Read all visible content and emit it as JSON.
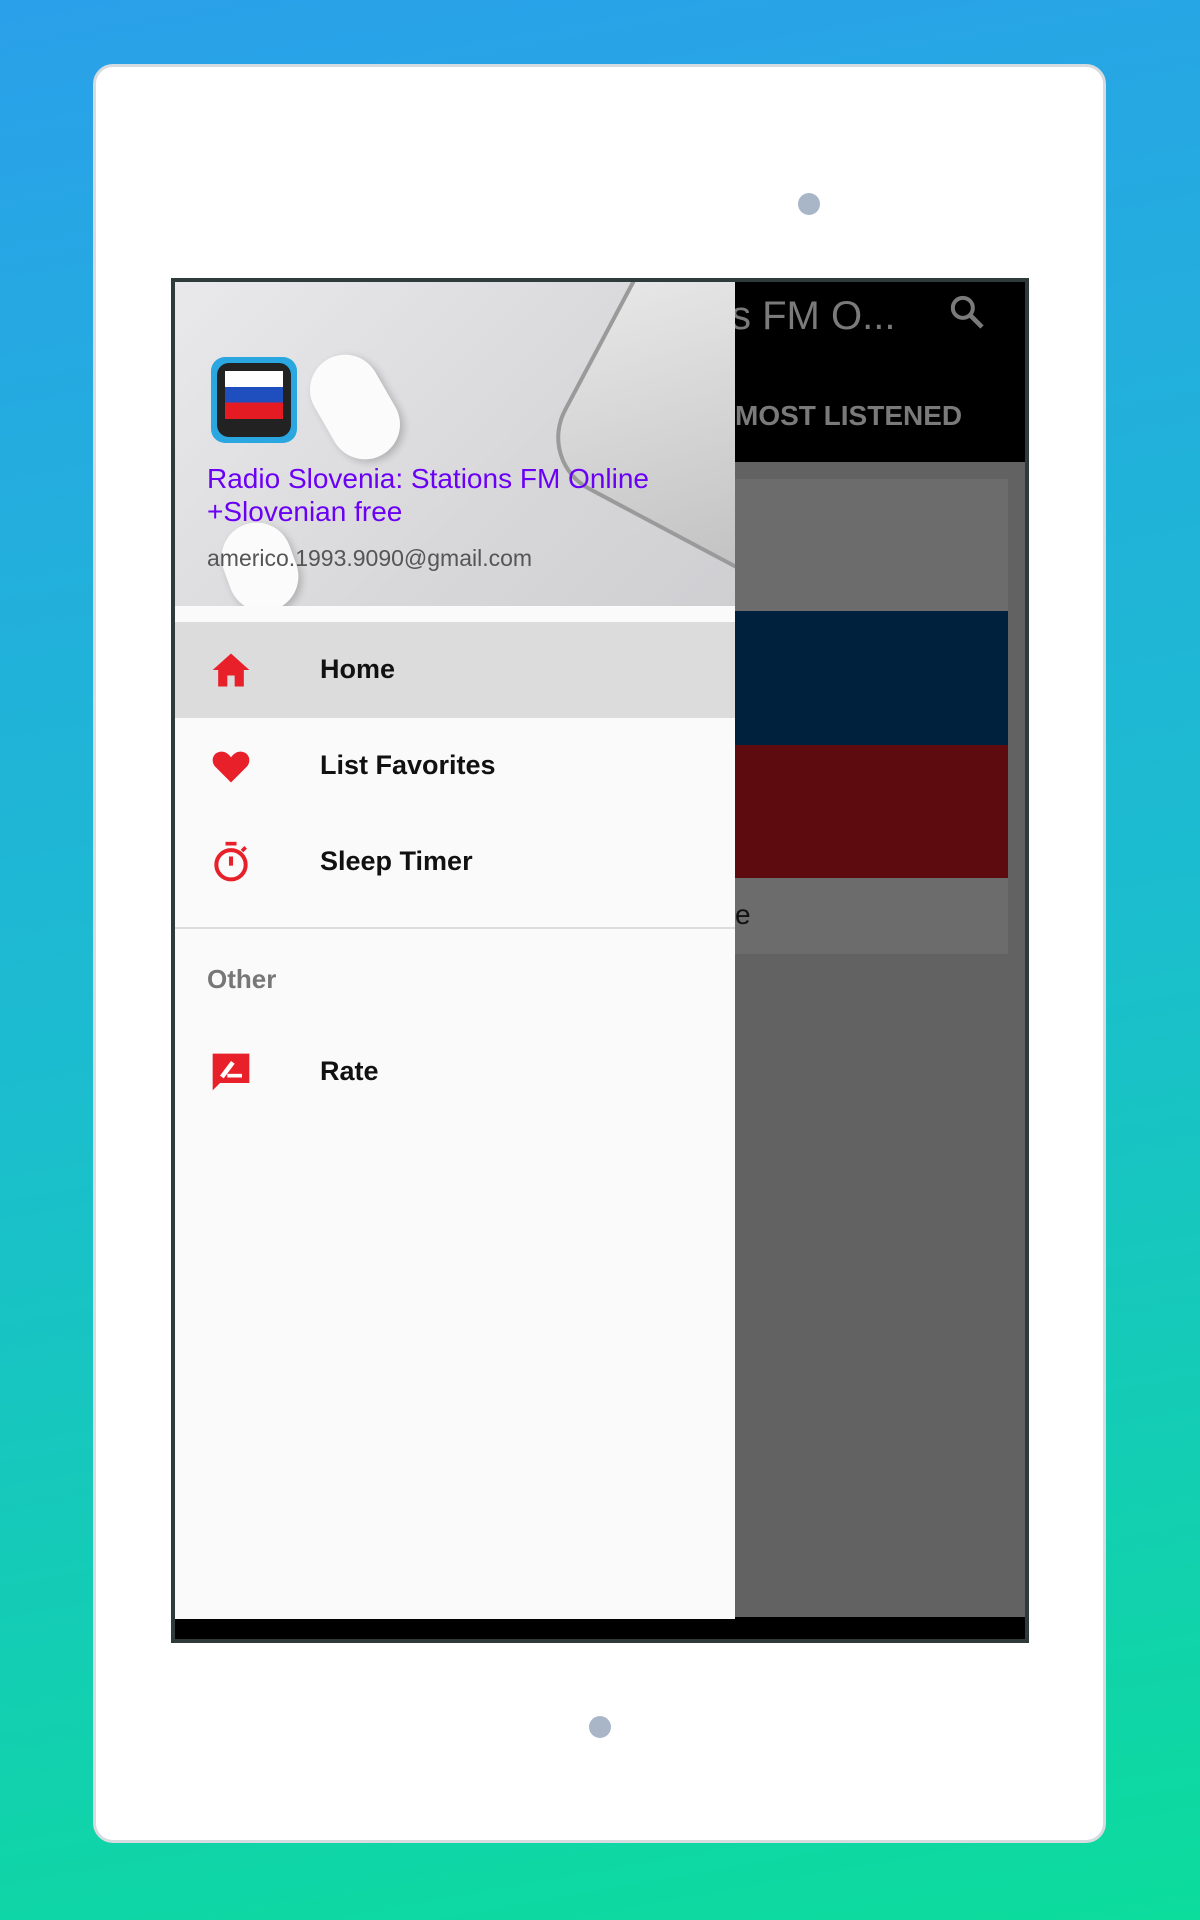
{
  "app": {
    "toolbar_title": "s FM O...",
    "tab_most_listened": "MOST LISTENED",
    "card_text": "e"
  },
  "drawer": {
    "app_name": "Radio Slovenia: Stations FM Online +Slovenian free",
    "email": "americo.1993.9090@gmail.com",
    "items": [
      {
        "label": "Home",
        "icon": "home-icon",
        "active": true
      },
      {
        "label": "List Favorites",
        "icon": "heart-icon"
      },
      {
        "label": "Sleep Timer",
        "icon": "timer-icon"
      }
    ],
    "section_title": "Other",
    "other_items": [
      {
        "label": "Rate",
        "icon": "rate-icon"
      }
    ]
  },
  "colors": {
    "accent": "#e8202a",
    "app_name": "#6a00f4",
    "toolbar": "#000000"
  }
}
